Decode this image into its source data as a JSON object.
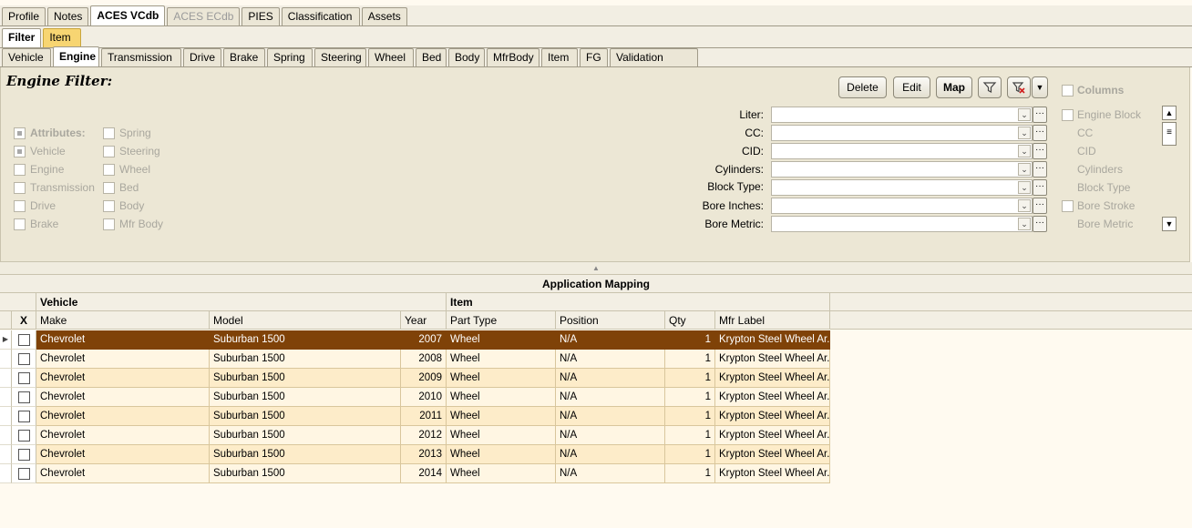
{
  "top_tabs": [
    "Profile",
    "Notes",
    "ACES VCdb",
    "ACES ECdb",
    "PIES",
    "Classification",
    "Assets"
  ],
  "mode_tabs": [
    "Filter",
    "Item"
  ],
  "attr_tabs": [
    "Vehicle",
    "Engine",
    "Transmission",
    "Drive",
    "Brake",
    "Spring",
    "Steering",
    "Wheel",
    "Bed",
    "Body",
    "MfrBody",
    "Item",
    "FG",
    "Validation"
  ],
  "filter": {
    "title": "Engine Filter:",
    "buttons": {
      "delete": "Delete",
      "edit": "Edit",
      "map": "Map"
    },
    "columns_label": "Columns",
    "attributes": {
      "col1": [
        "Attributes:",
        "Vehicle",
        "Engine",
        "Transmission",
        "Drive",
        "Brake"
      ],
      "col2": [
        "Spring",
        "Steering",
        "Wheel",
        "Bed",
        "Body",
        "Mfr Body"
      ]
    },
    "fields": [
      "Liter:",
      "CC:",
      "CID:",
      "Cylinders:",
      "Block Type:",
      "Bore Inches:",
      "Bore Metric:"
    ],
    "columns_list": [
      "Engine Block",
      "CC",
      "CID",
      "Cylinders",
      "Block Type",
      "Bore Stroke",
      "Bore Metric"
    ]
  },
  "grid": {
    "title": "Application Mapping",
    "group_headers": {
      "vehicle": "Vehicle",
      "item": "Item"
    },
    "columns": {
      "x": "X",
      "make": "Make",
      "model": "Model",
      "year": "Year",
      "part_type": "Part Type",
      "position": "Position",
      "qty": "Qty",
      "mfr_label": "Mfr Label"
    },
    "rows": [
      {
        "make": "Chevrolet",
        "model": "Suburban 1500",
        "year": "2007",
        "part_type": "Wheel",
        "position": "N/A",
        "qty": "1",
        "mfr_label": "Krypton Steel Wheel Ar..."
      },
      {
        "make": "Chevrolet",
        "model": "Suburban 1500",
        "year": "2008",
        "part_type": "Wheel",
        "position": "N/A",
        "qty": "1",
        "mfr_label": "Krypton Steel Wheel Ar..."
      },
      {
        "make": "Chevrolet",
        "model": "Suburban 1500",
        "year": "2009",
        "part_type": "Wheel",
        "position": "N/A",
        "qty": "1",
        "mfr_label": "Krypton Steel Wheel Ar..."
      },
      {
        "make": "Chevrolet",
        "model": "Suburban 1500",
        "year": "2010",
        "part_type": "Wheel",
        "position": "N/A",
        "qty": "1",
        "mfr_label": "Krypton Steel Wheel Ar..."
      },
      {
        "make": "Chevrolet",
        "model": "Suburban 1500",
        "year": "2011",
        "part_type": "Wheel",
        "position": "N/A",
        "qty": "1",
        "mfr_label": "Krypton Steel Wheel Ar..."
      },
      {
        "make": "Chevrolet",
        "model": "Suburban 1500",
        "year": "2012",
        "part_type": "Wheel",
        "position": "N/A",
        "qty": "1",
        "mfr_label": "Krypton Steel Wheel Ar..."
      },
      {
        "make": "Chevrolet",
        "model": "Suburban 1500",
        "year": "2013",
        "part_type": "Wheel",
        "position": "N/A",
        "qty": "1",
        "mfr_label": "Krypton Steel Wheel Ar..."
      },
      {
        "make": "Chevrolet",
        "model": "Suburban 1500",
        "year": "2014",
        "part_type": "Wheel",
        "position": "N/A",
        "qty": "1",
        "mfr_label": "Krypton Steel Wheel Ar..."
      }
    ]
  },
  "colors": {
    "selected_row": "#7f4208",
    "row_odd": "#fff6e3",
    "row_even": "#fdecc9",
    "item_tab": "#f7d572"
  }
}
